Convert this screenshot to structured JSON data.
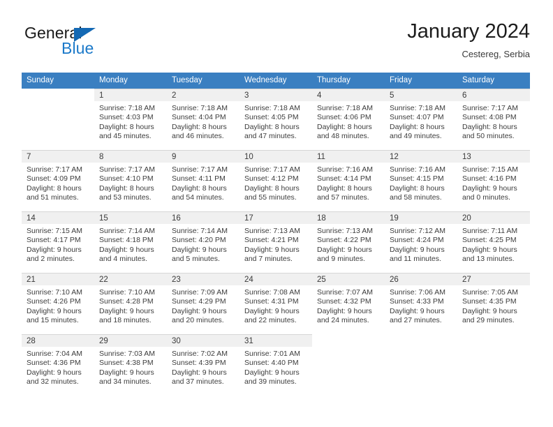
{
  "brand": {
    "name_top": "General",
    "name_bottom": "Blue",
    "triangle_color": "#1469b4",
    "blue_color": "#1b79c9"
  },
  "header": {
    "title": "January 2024",
    "subtitle": "Cestereg, Serbia"
  },
  "calendar": {
    "header_bg": "#3a7fc1",
    "daynum_bg": "#f0f0f0",
    "weekday_headers": [
      "Sunday",
      "Monday",
      "Tuesday",
      "Wednesday",
      "Thursday",
      "Friday",
      "Saturday"
    ],
    "weeks": [
      [
        {
          "day": "",
          "empty": true
        },
        {
          "day": "1",
          "sunrise": "Sunrise: 7:18 AM",
          "sunset": "Sunset: 4:03 PM",
          "daylight_line1": "Daylight: 8 hours",
          "daylight_line2": "and 45 minutes."
        },
        {
          "day": "2",
          "sunrise": "Sunrise: 7:18 AM",
          "sunset": "Sunset: 4:04 PM",
          "daylight_line1": "Daylight: 8 hours",
          "daylight_line2": "and 46 minutes."
        },
        {
          "day": "3",
          "sunrise": "Sunrise: 7:18 AM",
          "sunset": "Sunset: 4:05 PM",
          "daylight_line1": "Daylight: 8 hours",
          "daylight_line2": "and 47 minutes."
        },
        {
          "day": "4",
          "sunrise": "Sunrise: 7:18 AM",
          "sunset": "Sunset: 4:06 PM",
          "daylight_line1": "Daylight: 8 hours",
          "daylight_line2": "and 48 minutes."
        },
        {
          "day": "5",
          "sunrise": "Sunrise: 7:18 AM",
          "sunset": "Sunset: 4:07 PM",
          "daylight_line1": "Daylight: 8 hours",
          "daylight_line2": "and 49 minutes."
        },
        {
          "day": "6",
          "sunrise": "Sunrise: 7:17 AM",
          "sunset": "Sunset: 4:08 PM",
          "daylight_line1": "Daylight: 8 hours",
          "daylight_line2": "and 50 minutes."
        }
      ],
      [
        {
          "day": "7",
          "sunrise": "Sunrise: 7:17 AM",
          "sunset": "Sunset: 4:09 PM",
          "daylight_line1": "Daylight: 8 hours",
          "daylight_line2": "and 51 minutes."
        },
        {
          "day": "8",
          "sunrise": "Sunrise: 7:17 AM",
          "sunset": "Sunset: 4:10 PM",
          "daylight_line1": "Daylight: 8 hours",
          "daylight_line2": "and 53 minutes."
        },
        {
          "day": "9",
          "sunrise": "Sunrise: 7:17 AM",
          "sunset": "Sunset: 4:11 PM",
          "daylight_line1": "Daylight: 8 hours",
          "daylight_line2": "and 54 minutes."
        },
        {
          "day": "10",
          "sunrise": "Sunrise: 7:17 AM",
          "sunset": "Sunset: 4:12 PM",
          "daylight_line1": "Daylight: 8 hours",
          "daylight_line2": "and 55 minutes."
        },
        {
          "day": "11",
          "sunrise": "Sunrise: 7:16 AM",
          "sunset": "Sunset: 4:14 PM",
          "daylight_line1": "Daylight: 8 hours",
          "daylight_line2": "and 57 minutes."
        },
        {
          "day": "12",
          "sunrise": "Sunrise: 7:16 AM",
          "sunset": "Sunset: 4:15 PM",
          "daylight_line1": "Daylight: 8 hours",
          "daylight_line2": "and 58 minutes."
        },
        {
          "day": "13",
          "sunrise": "Sunrise: 7:15 AM",
          "sunset": "Sunset: 4:16 PM",
          "daylight_line1": "Daylight: 9 hours",
          "daylight_line2": "and 0 minutes."
        }
      ],
      [
        {
          "day": "14",
          "sunrise": "Sunrise: 7:15 AM",
          "sunset": "Sunset: 4:17 PM",
          "daylight_line1": "Daylight: 9 hours",
          "daylight_line2": "and 2 minutes."
        },
        {
          "day": "15",
          "sunrise": "Sunrise: 7:14 AM",
          "sunset": "Sunset: 4:18 PM",
          "daylight_line1": "Daylight: 9 hours",
          "daylight_line2": "and 4 minutes."
        },
        {
          "day": "16",
          "sunrise": "Sunrise: 7:14 AM",
          "sunset": "Sunset: 4:20 PM",
          "daylight_line1": "Daylight: 9 hours",
          "daylight_line2": "and 5 minutes."
        },
        {
          "day": "17",
          "sunrise": "Sunrise: 7:13 AM",
          "sunset": "Sunset: 4:21 PM",
          "daylight_line1": "Daylight: 9 hours",
          "daylight_line2": "and 7 minutes."
        },
        {
          "day": "18",
          "sunrise": "Sunrise: 7:13 AM",
          "sunset": "Sunset: 4:22 PM",
          "daylight_line1": "Daylight: 9 hours",
          "daylight_line2": "and 9 minutes."
        },
        {
          "day": "19",
          "sunrise": "Sunrise: 7:12 AM",
          "sunset": "Sunset: 4:24 PM",
          "daylight_line1": "Daylight: 9 hours",
          "daylight_line2": "and 11 minutes."
        },
        {
          "day": "20",
          "sunrise": "Sunrise: 7:11 AM",
          "sunset": "Sunset: 4:25 PM",
          "daylight_line1": "Daylight: 9 hours",
          "daylight_line2": "and 13 minutes."
        }
      ],
      [
        {
          "day": "21",
          "sunrise": "Sunrise: 7:10 AM",
          "sunset": "Sunset: 4:26 PM",
          "daylight_line1": "Daylight: 9 hours",
          "daylight_line2": "and 15 minutes."
        },
        {
          "day": "22",
          "sunrise": "Sunrise: 7:10 AM",
          "sunset": "Sunset: 4:28 PM",
          "daylight_line1": "Daylight: 9 hours",
          "daylight_line2": "and 18 minutes."
        },
        {
          "day": "23",
          "sunrise": "Sunrise: 7:09 AM",
          "sunset": "Sunset: 4:29 PM",
          "daylight_line1": "Daylight: 9 hours",
          "daylight_line2": "and 20 minutes."
        },
        {
          "day": "24",
          "sunrise": "Sunrise: 7:08 AM",
          "sunset": "Sunset: 4:31 PM",
          "daylight_line1": "Daylight: 9 hours",
          "daylight_line2": "and 22 minutes."
        },
        {
          "day": "25",
          "sunrise": "Sunrise: 7:07 AM",
          "sunset": "Sunset: 4:32 PM",
          "daylight_line1": "Daylight: 9 hours",
          "daylight_line2": "and 24 minutes."
        },
        {
          "day": "26",
          "sunrise": "Sunrise: 7:06 AM",
          "sunset": "Sunset: 4:33 PM",
          "daylight_line1": "Daylight: 9 hours",
          "daylight_line2": "and 27 minutes."
        },
        {
          "day": "27",
          "sunrise": "Sunrise: 7:05 AM",
          "sunset": "Sunset: 4:35 PM",
          "daylight_line1": "Daylight: 9 hours",
          "daylight_line2": "and 29 minutes."
        }
      ],
      [
        {
          "day": "28",
          "sunrise": "Sunrise: 7:04 AM",
          "sunset": "Sunset: 4:36 PM",
          "daylight_line1": "Daylight: 9 hours",
          "daylight_line2": "and 32 minutes."
        },
        {
          "day": "29",
          "sunrise": "Sunrise: 7:03 AM",
          "sunset": "Sunset: 4:38 PM",
          "daylight_line1": "Daylight: 9 hours",
          "daylight_line2": "and 34 minutes."
        },
        {
          "day": "30",
          "sunrise": "Sunrise: 7:02 AM",
          "sunset": "Sunset: 4:39 PM",
          "daylight_line1": "Daylight: 9 hours",
          "daylight_line2": "and 37 minutes."
        },
        {
          "day": "31",
          "sunrise": "Sunrise: 7:01 AM",
          "sunset": "Sunset: 4:40 PM",
          "daylight_line1": "Daylight: 9 hours",
          "daylight_line2": "and 39 minutes."
        },
        {
          "day": "",
          "empty": true
        },
        {
          "day": "",
          "empty": true
        },
        {
          "day": "",
          "empty": true
        }
      ]
    ]
  }
}
